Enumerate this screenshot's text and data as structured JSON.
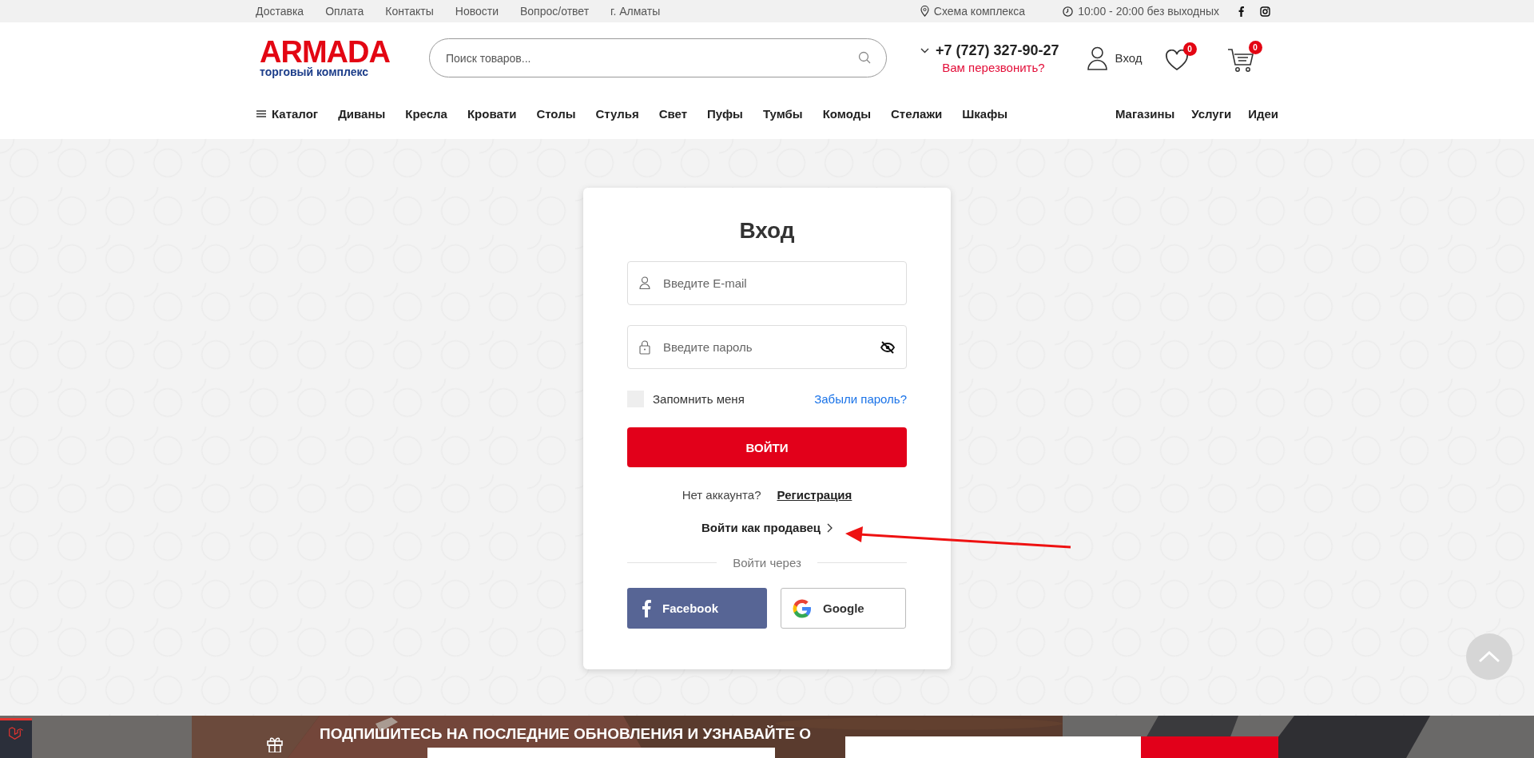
{
  "top_bar": {
    "links": [
      "Доставка",
      "Оплата",
      "Контакты",
      "Новости",
      "Вопрос/ответ",
      "г. Алматы"
    ],
    "location": "Схема комплекса",
    "hours": "10:00 - 20:00 без выходных"
  },
  "header": {
    "logo": {
      "name": "ARMADA",
      "tagline": "торговый комплекс"
    },
    "search": {
      "placeholder": "Поиск товаров..."
    },
    "phone": "+7 (727) 327-90-27",
    "callback": "Вам перезвонить?",
    "login": "Вход",
    "wishlist_count": "0",
    "cart_count": "0"
  },
  "nav": {
    "catalog": "Каталог",
    "items": [
      "Диваны",
      "Кресла",
      "Кровати",
      "Столы",
      "Стулья",
      "Свет",
      "Пуфы",
      "Тумбы",
      "Комоды",
      "Стелажи",
      "Шкафы"
    ],
    "right_items": [
      "Магазины",
      "Услуги",
      "Идеи"
    ]
  },
  "login": {
    "title": "Вход",
    "email": {
      "placeholder": "Введите E-mail"
    },
    "password": {
      "placeholder": "Введите пароль"
    },
    "remember": {
      "label": "Запомнить меня",
      "checked": false
    },
    "forgot": "Забыли пароль?",
    "submit": "ВОЙТИ",
    "no_account": "Нет аккаунта?",
    "register": "Регистрация",
    "seller": "Войти как продавец",
    "via": "Войти через",
    "social": [
      {
        "kind": "facebook",
        "label": "Facebook"
      },
      {
        "kind": "google",
        "label": "Google"
      }
    ]
  },
  "subscribe": {
    "heading": "ПОДПИШИТЕСЬ НА ПОСЛЕДНИЕ ОБНОВЛЕНИЯ И УЗНАВАЙТЕ О"
  }
}
